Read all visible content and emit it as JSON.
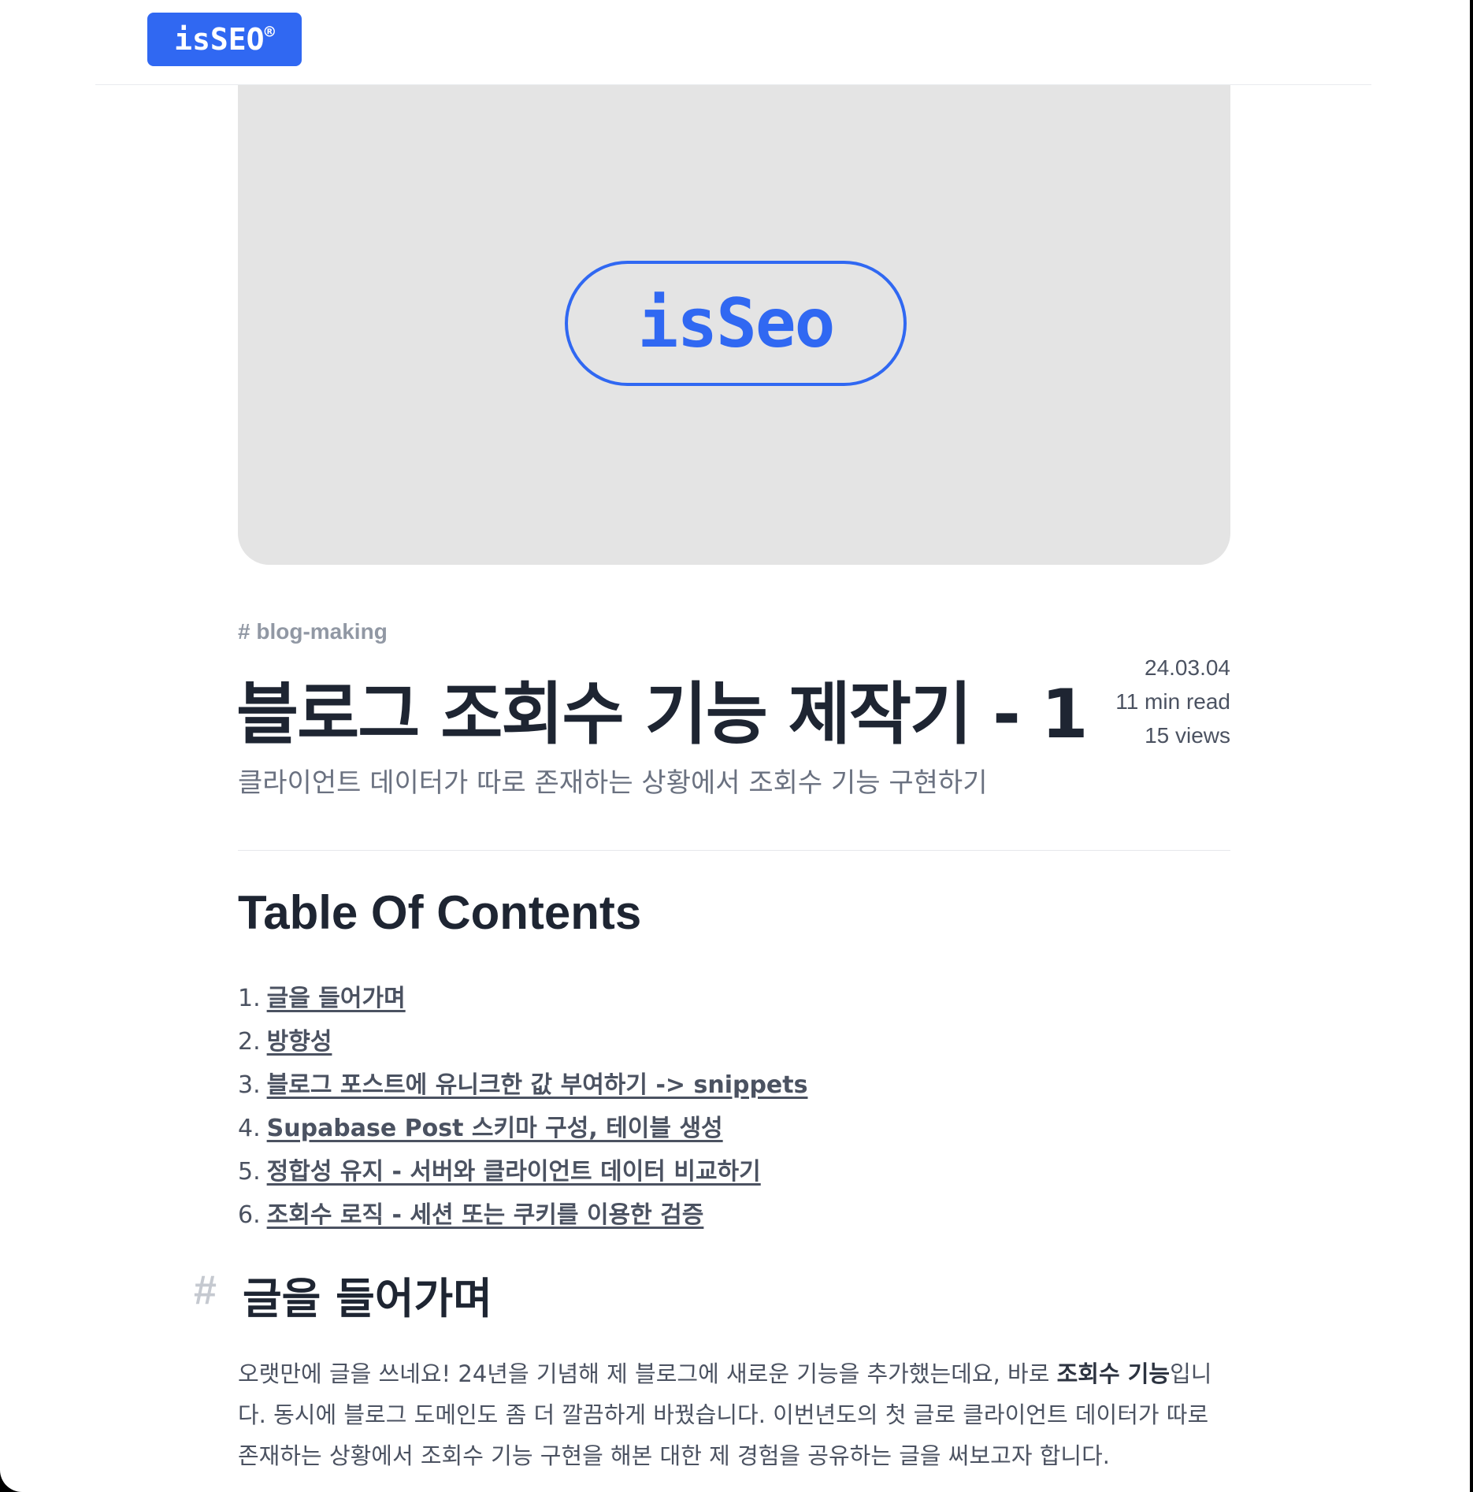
{
  "header": {
    "logo_text": "isSEO",
    "logo_mark": "®"
  },
  "hero": {
    "logo_text": "isSeo"
  },
  "post": {
    "tag": "# blog-making",
    "title": "블로그 조회수 기능 제작기 - 1",
    "subtitle": "클라이언트 데이터가 따로 존재하는 상황에서 조회수 기능 구현하기",
    "date": "24.03.04",
    "read_time": "11 min read",
    "views": "15 views"
  },
  "toc": {
    "heading": "Table Of Contents",
    "items": [
      {
        "num": "1.",
        "label": "글을 들어가며"
      },
      {
        "num": "2.",
        "label": "방향성"
      },
      {
        "num": "3.",
        "label": "블로그 포스트에 유니크한 값 부여하기 -> snippets"
      },
      {
        "num": "4.",
        "label": "Supabase Post 스키마 구성, 테이블 생성"
      },
      {
        "num": "5.",
        "label": "정합성 유지 - 서버와 클라이언트 데이터 비교하기"
      },
      {
        "num": "6.",
        "label": "조회수 로직 - 세션 또는 쿠키를 이용한 검증"
      }
    ]
  },
  "section": {
    "hash": "#",
    "heading": "글을 들어가며",
    "para_part1": "오랫만에 글을 쓰네요! 24년을 기념해 제 블로그에 새로운 기능을 추가했는데요, 바로 ",
    "para_bold": "조회수 기능",
    "para_part2": "입니다. 동시에 블로그 도메인도 좀 더 깔끔하게 바꿨습니다. 이번년도의 첫 글로 클라이언트 데이터가 따로 존재하는 상황에서 조회수 기능 구현을 해본 대한 제 경험을 공유하는 글을 써보고자 합니다."
  },
  "colors": {
    "brand": "#3068f2",
    "hero_bg": "#e4e4e4",
    "text_dark": "#1e2532",
    "text_muted": "#4b5261"
  }
}
